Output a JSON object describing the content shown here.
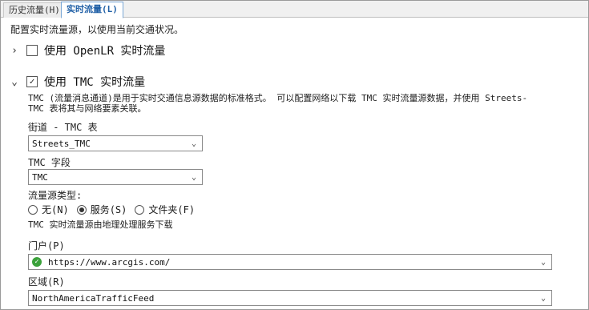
{
  "tabs": [
    {
      "label": "历史流量(H)",
      "active": false
    },
    {
      "label": "实时流量(L)",
      "active": true
    }
  ],
  "description": "配置实时流量源，以使用当前交通状况。",
  "openlr": {
    "label": "使用 OpenLR 实时流量",
    "checked": false,
    "expanded": false
  },
  "tmc": {
    "label": "使用 TMC 实时流量",
    "checked": true,
    "expanded": true,
    "info_line1": "TMC (流量消息通道)是用于实时交通信息源数据的标准格式。 可以配置网络以下载 TMC 实时流量源数据，并使用 Streets-",
    "info_line2": "TMC 表将其与网络要素关联。",
    "streets_table_label": "街道 - TMC 表",
    "streets_table_value": "Streets_TMC",
    "tmc_field_label": "TMC 字段",
    "tmc_field_value": "TMC",
    "source_type_label": "流量源类型:",
    "source_types": [
      {
        "label": "无(N)",
        "selected": false
      },
      {
        "label": "服务(S)",
        "selected": true
      },
      {
        "label": "文件夹(F)",
        "selected": false
      }
    ],
    "source_note": "TMC 实时流量源由地理处理服务下载",
    "portal_label": "门户(P)",
    "portal_value": "https://www.arcgis.com/",
    "region_label": "区域(R)",
    "region_value": "NorthAmericaTrafficFeed"
  },
  "icons": {
    "collapsed": "chevron-right-icon",
    "expanded": "chevron-down-icon",
    "portal_status": "check-circle-icon",
    "dropdown": "chevron-down-icon"
  },
  "colors": {
    "active_tab": "#1f5fa6",
    "status_ok": "#3aa13a"
  }
}
